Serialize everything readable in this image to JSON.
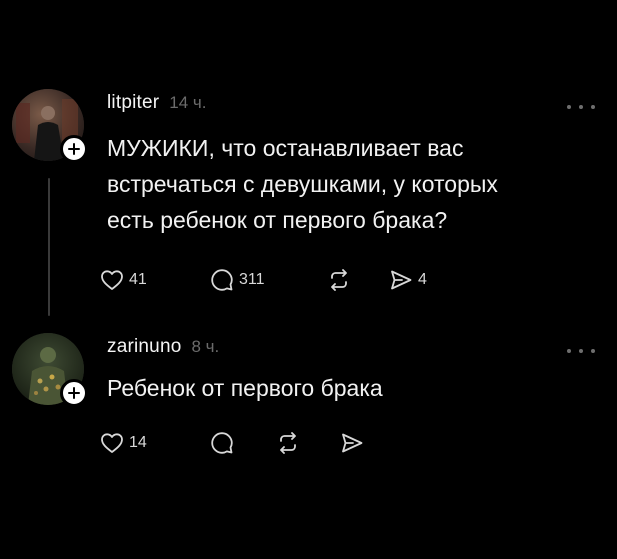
{
  "posts": [
    {
      "username": "litpiter",
      "timestamp": "14 ч.",
      "text_lines": [
        "МУЖИКИ, что останавливает вас",
        "встречаться с девушками, у которых",
        "есть ребенок от первого брака?"
      ],
      "likes": "41",
      "comments": "311",
      "reposts": "",
      "shares": "4"
    },
    {
      "username": "zarinuno",
      "timestamp": "8 ч.",
      "text_lines": [
        "Ребенок от первого брака"
      ],
      "likes": "14",
      "comments": "",
      "reposts": "",
      "shares": ""
    }
  ],
  "icons": {
    "like": "heart-icon",
    "comment": "comment-icon",
    "repost": "repost-icon",
    "share": "send-icon",
    "more": "more-horizontal-icon",
    "follow": "plus-icon"
  },
  "colors": {
    "background": "#000000",
    "text": "#f2f2f2",
    "muted": "#6b6b6b",
    "thread_line": "#3a3a3a"
  }
}
